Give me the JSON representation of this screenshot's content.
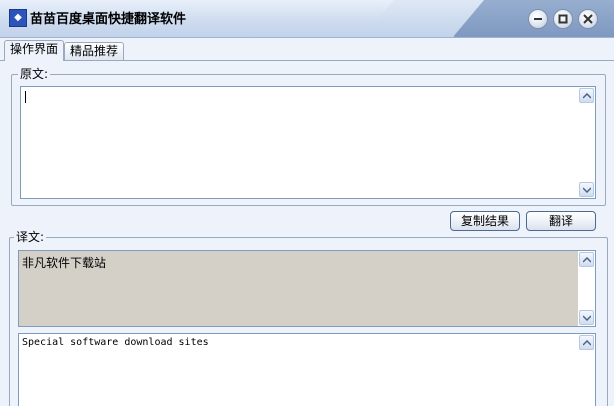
{
  "window": {
    "title": "苗苗百度桌面快捷翻译软件"
  },
  "tabs": [
    {
      "label": "操作界面",
      "active": true
    },
    {
      "label": "精品推荐",
      "active": false
    }
  ],
  "source": {
    "legend": "原文:",
    "value": ""
  },
  "actions": {
    "copy_label": "复制结果",
    "translate_label": "翻译"
  },
  "result": {
    "legend": "译文:",
    "chinese_value": "非凡软件下载站",
    "english_value": "Special software download sites"
  },
  "icons": [
    "app-icon",
    "minimize-icon",
    "maximize-icon",
    "close-icon",
    "scroll-up-icon",
    "scroll-down-icon"
  ],
  "colors": {
    "titlebar": "#c1d2ea",
    "window_bg": "#eef3fb",
    "readonly_bg": "#d4d0c8",
    "border": "#7f9db9"
  }
}
